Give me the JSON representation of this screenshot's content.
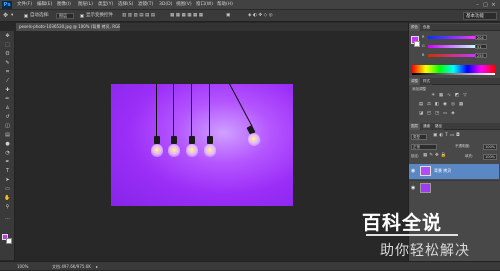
{
  "app": {
    "logo": "Ps"
  },
  "menu": [
    "文件(F)",
    "编辑(E)",
    "图像(I)",
    "图层(L)",
    "类型(Y)",
    "选择(S)",
    "滤镜(T)",
    "3D(D)",
    "视图(V)",
    "窗口(W)",
    "帮助(H)"
  ],
  "options": {
    "auto_select_label": "自动选择:",
    "auto_select_value": "图层",
    "show_transform_label": "显示变换控件",
    "workspace": "基本功能"
  },
  "document": {
    "tab_title": "pexels-photo-1036530.jpg @ 100% (背景 拷贝, RGB/8)"
  },
  "status": {
    "zoom": "100%",
    "doc_size": "文档:497.6K/975.6K"
  },
  "color_panel": {
    "tabs": [
      "颜色",
      "色板"
    ],
    "channels": [
      {
        "label": "R",
        "value": "204"
      },
      {
        "label": "G",
        "value": "51"
      },
      {
        "label": "B",
        "value": "255"
      }
    ],
    "swatch_colors": [
      "#ff0000",
      "#ff6600",
      "#ffff00",
      "#00ff00",
      "#00ffff",
      "#0066ff",
      "#ff00ff",
      "#ffffff",
      "#999999",
      "#000000"
    ]
  },
  "adjustments": {
    "tabs": [
      "调整",
      "样式"
    ],
    "add_label": "添加调整"
  },
  "layers": {
    "tabs": [
      "图层",
      "通道",
      "路径"
    ],
    "filter_label": "类型",
    "blend_mode": "正常",
    "opacity_label": "不透明度:",
    "opacity_value": "100%",
    "lock_label": "锁定:",
    "fill_label": "填充:",
    "fill_value": "100%",
    "items": [
      {
        "name": "背景 拷贝"
      }
    ]
  },
  "watermark": {
    "title": "百科全说",
    "subtitle": "助你轻松解决"
  },
  "colors": {
    "foreground": "#cc33ff",
    "background": "#ffffff",
    "photo_purple": "#a03bf5",
    "selected_layer": "#5a88c4"
  },
  "tools": [
    "move-icon",
    "marquee-icon",
    "lasso-icon",
    "quick-select-icon",
    "crop-icon",
    "eyedropper-icon",
    "healing-icon",
    "brush-icon",
    "stamp-icon",
    "history-brush-icon",
    "eraser-icon",
    "gradient-icon",
    "blur-icon",
    "dodge-icon",
    "pen-icon",
    "type-icon",
    "path-select-icon",
    "shape-icon",
    "hand-icon",
    "zoom-icon"
  ]
}
